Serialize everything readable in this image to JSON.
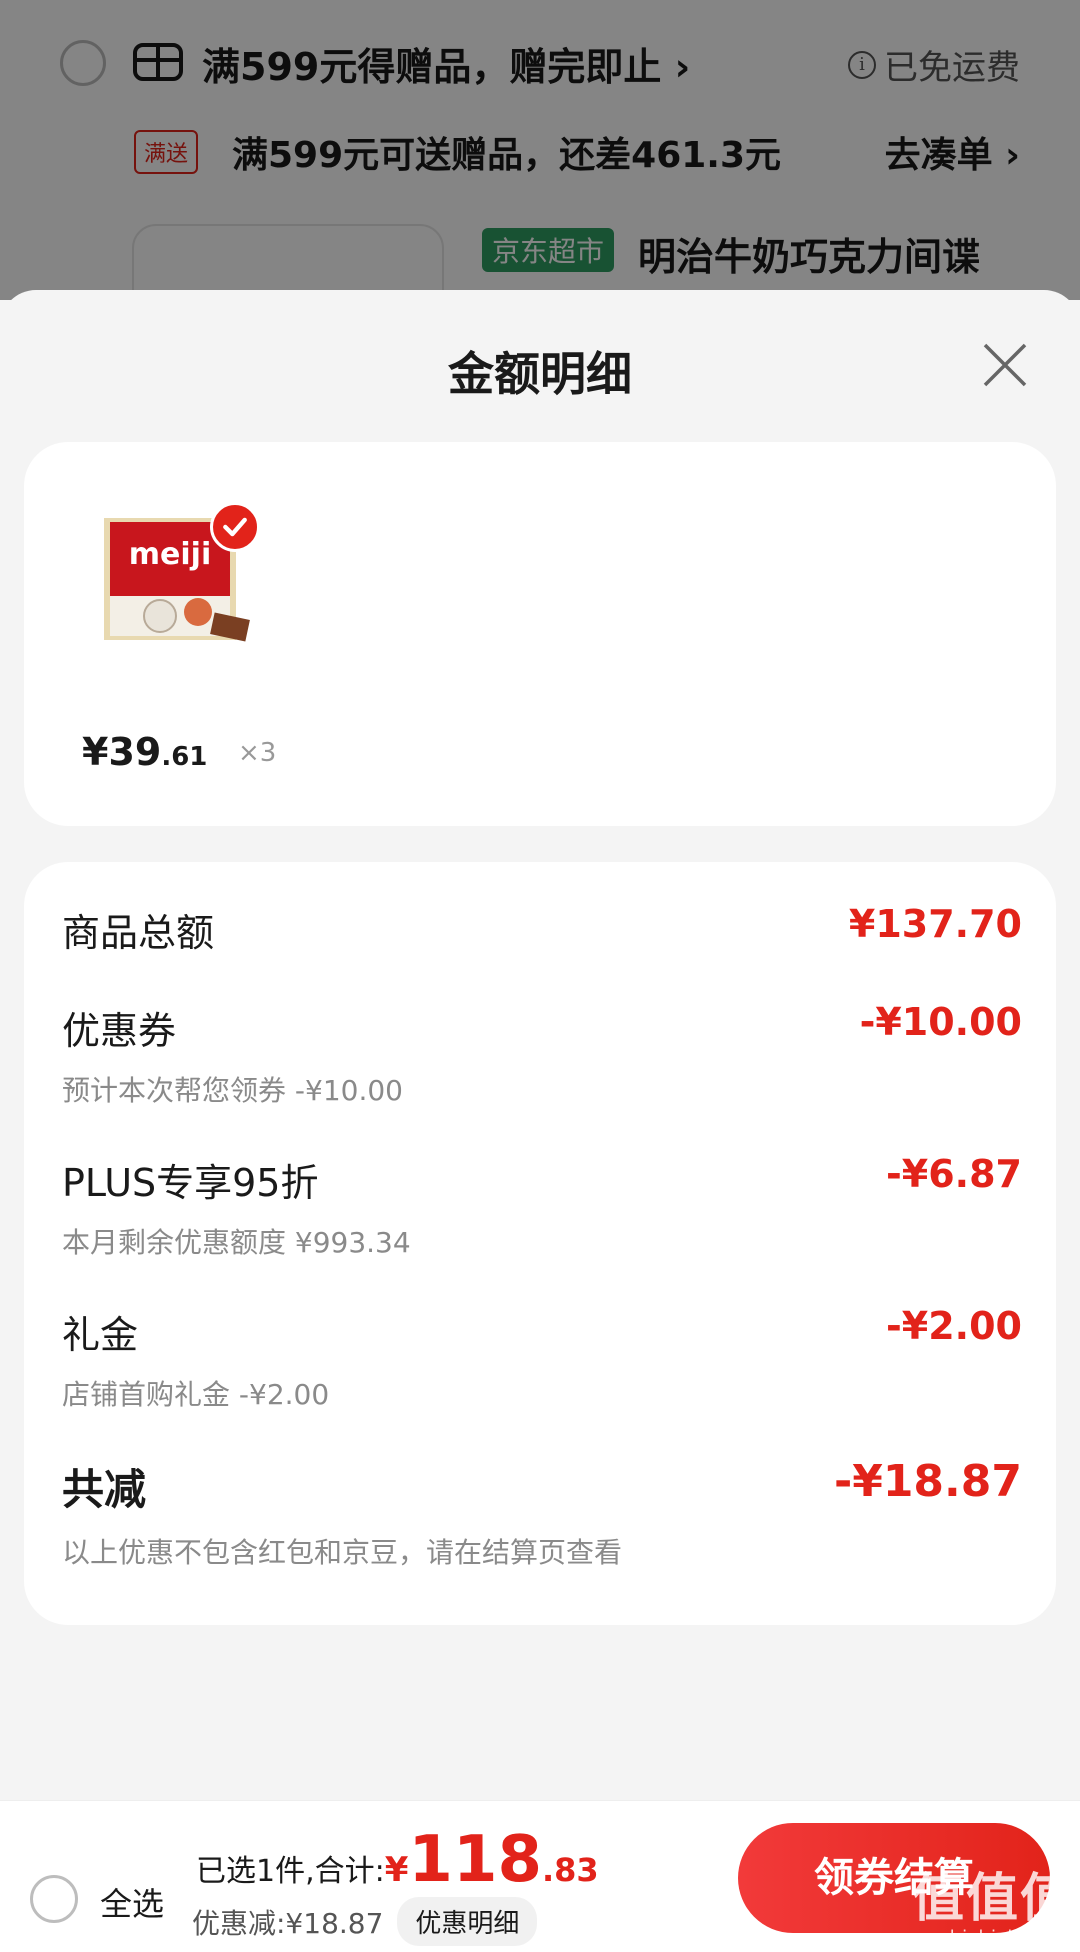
{
  "background": {
    "store_text": "满599元得赠品，赠完即止",
    "store_chevron": "›",
    "shipping": "已免运费",
    "promo_tag": "满送",
    "promo_text": "满599元可送赠品，还差461.3元",
    "coudan": "去凑单",
    "coudan_chevron": "›",
    "channel_tag": "京东超市",
    "product_title": "明治牛奶巧克力间谍"
  },
  "sheet": {
    "title": "金额明细",
    "goods": {
      "price_symbol": "¥",
      "price_int": "39",
      "price_dec": ".61",
      "quantity": "×3"
    },
    "rows": [
      {
        "label": "商品总额",
        "sub": "",
        "amount": "¥137.70"
      },
      {
        "label": "优惠券",
        "sub": "预计本次帮您领券 -¥10.00",
        "amount": "-¥10.00"
      },
      {
        "label": "PLUS专享95折",
        "sub": "本月剩余优惠额度 ¥993.34",
        "amount": "-¥6.87"
      },
      {
        "label": "礼金",
        "sub": "店铺首购礼金 -¥2.00",
        "amount": "-¥2.00"
      }
    ],
    "total": {
      "label": "共减",
      "sub": "以上优惠不包含红包和京豆，请在结算页查看",
      "amount": "-¥18.87"
    }
  },
  "bottom_bar": {
    "select_all": "全选",
    "sum_label": "已选1件,合计:",
    "sum_yen": "¥",
    "sum_int": "118",
    "sum_dec": ".83",
    "discount": "优惠减:¥18.87",
    "discount_detail": "优惠明细",
    "checkout": "领券结算",
    "watermark": "值值值",
    "watermark_site": "zhizhizhi.com"
  },
  "colors": {
    "accent_red": "#e2231a",
    "jd_green": "#2e9e63"
  }
}
